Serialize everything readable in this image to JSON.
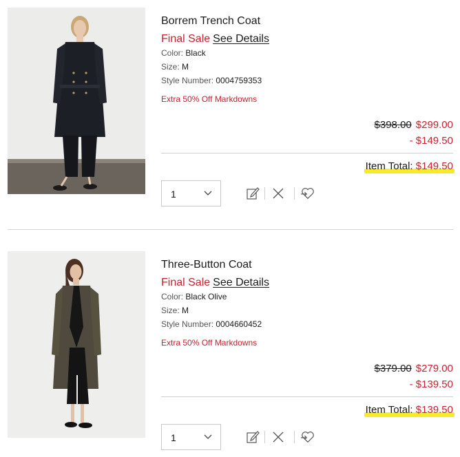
{
  "items": [
    {
      "name": "Borrem Trench Coat",
      "final_sale": "Final Sale",
      "see_details": "See Details",
      "color_label": "Color:",
      "color": "Black",
      "size_label": "Size:",
      "size": "M",
      "style_label": "Style Number:",
      "style_number": "0004759353",
      "promo": "Extra 50% Off Markdowns",
      "original_price": "$398.00",
      "sale_price": "$299.00",
      "discount": "- $149.50",
      "total_label": "Item Total:",
      "total": "$149.50",
      "quantity": "1"
    },
    {
      "name": "Three-Button Coat",
      "final_sale": "Final Sale",
      "see_details": "See Details",
      "color_label": "Color:",
      "color": "Black Olive",
      "size_label": "Size:",
      "size": "M",
      "style_label": "Style Number:",
      "style_number": "0004660452",
      "promo": "Extra 50% Off Markdowns",
      "original_price": "$379.00",
      "sale_price": "$279.00",
      "discount": "- $139.50",
      "total_label": "Item Total:",
      "total": "$139.50",
      "quantity": "1"
    }
  ],
  "icons": {
    "edit": "edit-icon",
    "remove": "close-icon",
    "save": "heart-icon",
    "chevron": "chevron-down-icon"
  },
  "colors": {
    "accent_red": "#c8202f",
    "highlight_yellow": "#f7ea2c"
  }
}
